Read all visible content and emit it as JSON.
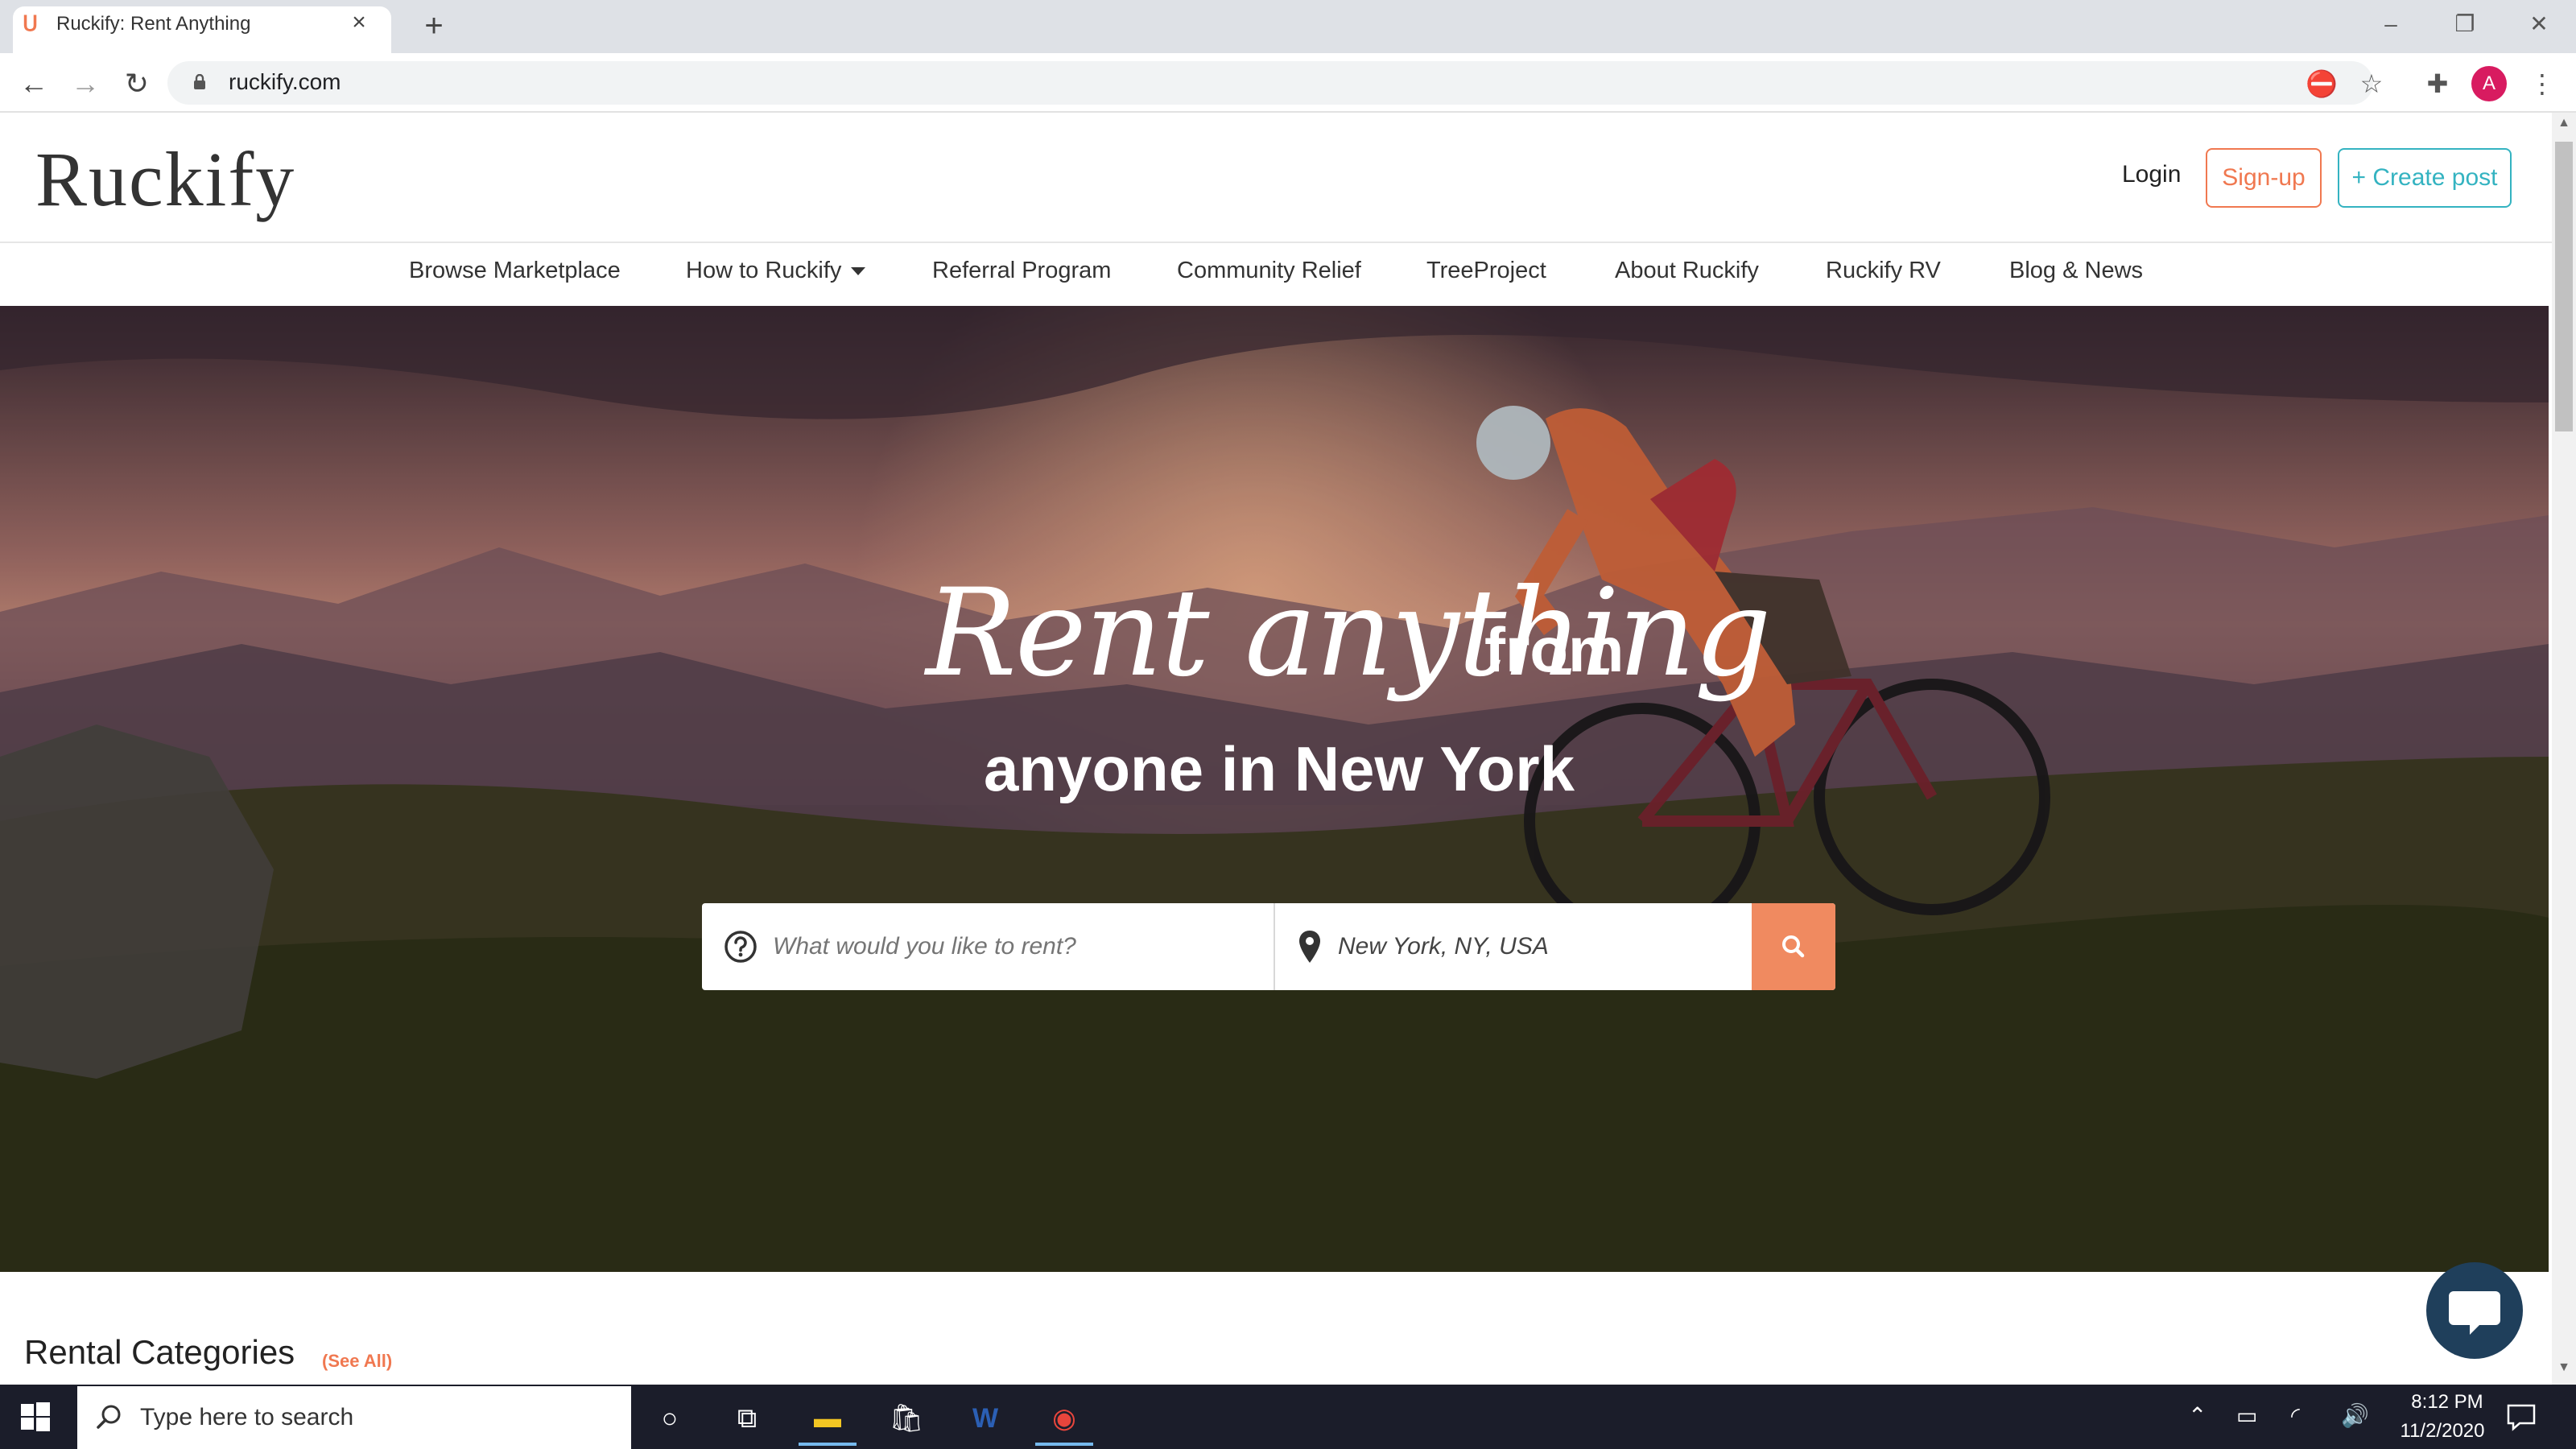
{
  "browser": {
    "tab_title": "Ruckify: Rent Anything",
    "url": "ruckify.com",
    "profile_initial": "A"
  },
  "site": {
    "logo": "Ruckify",
    "header": {
      "login": "Login",
      "signup": "Sign-up",
      "create_post": "+ Create post"
    },
    "nav": [
      {
        "label": "Browse Marketplace"
      },
      {
        "label": "How to Ruckify"
      },
      {
        "label": "Referral Program"
      },
      {
        "label": "Community Relief"
      },
      {
        "label": "TreeProject"
      },
      {
        "label": "About Ruckify"
      },
      {
        "label": "Ruckify RV"
      },
      {
        "label": "Blog & News"
      }
    ],
    "hero": {
      "headline_script": "Rent anything",
      "headline_from": "from",
      "headline_line2": "anyone in New York",
      "search_placeholder": "What would you like to rent?",
      "location_value": "New York, NY, USA"
    },
    "categories": {
      "title": "Rental Categories",
      "see_all": "(See All)"
    }
  },
  "taskbar": {
    "search_placeholder": "Type here to search",
    "time": "8:12 PM",
    "date": "11/2/2020"
  },
  "colors": {
    "accent_orange": "#f07850",
    "accent_teal": "#34b3c1",
    "chat_bubble": "#1f3f5b"
  }
}
